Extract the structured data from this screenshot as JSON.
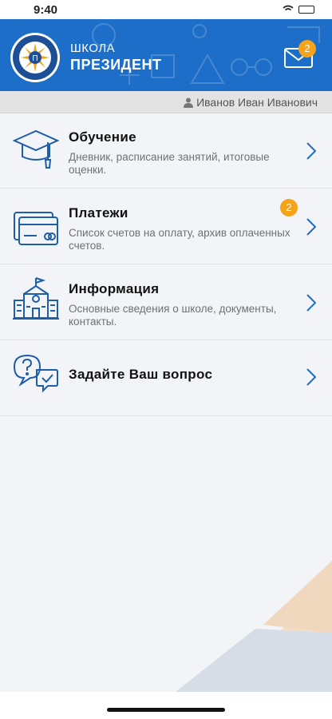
{
  "status": {
    "time": "9:40"
  },
  "header": {
    "logo_icon": "president-school-emblem",
    "brand_line1": "ШКОЛА",
    "brand_line2": "ПРЕЗИДЕНТ",
    "mail_icon": "envelope-icon",
    "mail_badge": "2",
    "bg_color": "#1d6ec8"
  },
  "user": {
    "name": "Иванов Иван Иванович",
    "icon": "person-icon"
  },
  "menu": [
    {
      "title": "Обучение",
      "description": "Дневник, расписание занятий, итоговые оценки.",
      "icon": "graduation-cap-icon"
    },
    {
      "title": "Платежи",
      "description": "Список счетов на оплату, архив оплаченных счетов.",
      "icon": "credit-card-icon",
      "badge": "2"
    },
    {
      "title": "Информация",
      "description": "Основные сведения о школе, документы, контакты.",
      "icon": "school-building-icon"
    },
    {
      "title": "Задайте Ваш вопрос",
      "description": "",
      "icon": "question-chat-icon"
    }
  ],
  "colors": {
    "accent": "#1d6ec8",
    "badge": "#f5a31a",
    "icon_stroke": "#1e5ea8"
  }
}
